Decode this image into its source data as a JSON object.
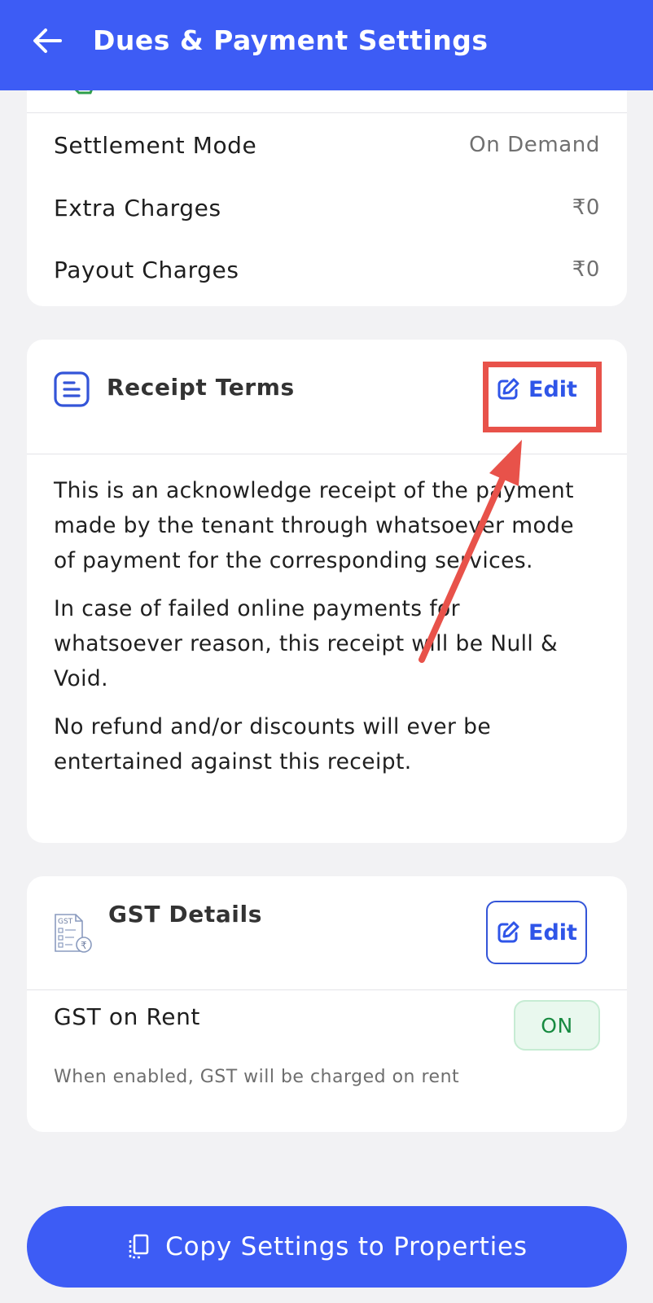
{
  "header": {
    "title": "Dues & Payment Settings",
    "back_icon": "arrow-left-icon"
  },
  "settlement": {
    "rows": [
      {
        "label": "Settlement Mode",
        "value": "On Demand"
      },
      {
        "label": "Extra Charges",
        "value": "₹0"
      },
      {
        "label": "Payout Charges",
        "value": "₹0"
      }
    ]
  },
  "receipt_terms": {
    "title": "Receipt Terms",
    "edit_label": "Edit",
    "paragraphs": [
      "This is an acknowledge receipt of the payment made by the tenant through whatsoever mode of payment for the corresponding services.",
      "In case of failed online payments for whatsoever reason, this receipt will be Null & Void.",
      "No refund and/or discounts will ever be entertained against this receipt."
    ]
  },
  "gst": {
    "title": "GST Details",
    "edit_label": "Edit",
    "icon_text": "GST",
    "rent_label": "GST on Rent",
    "toggle_label": "ON",
    "hint": "When enabled, GST will be charged on rent"
  },
  "footer": {
    "copy_label": "Copy Settings to Properties"
  },
  "colors": {
    "primary": "#3d5cf5",
    "annotation": "#e8524a",
    "toggle_on": "#178a40"
  }
}
